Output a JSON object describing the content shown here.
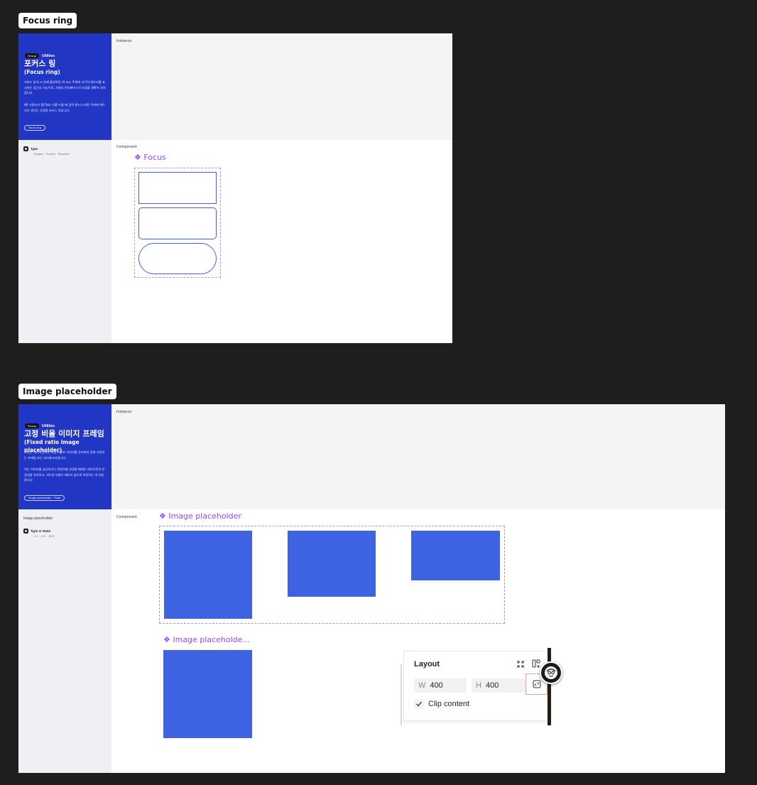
{
  "focus_section": {
    "tag": "Focus ring",
    "hero": {
      "badge": "Group",
      "category": "Utilities",
      "title_ko": "포커스 링",
      "title_en": "(Focus ring)",
      "desc1": "키보드 탐색 시 현재 활성화된 UI 요소 주위에 시각적 테두리를 표시하는 접근성 기능으로, 사용자 인터페이스의 초점을 명확히 보여줍니다.",
      "desc2": "예) 사용자가 탭(Tab) 키를 누를 때 입력 필드나 버튼 주위에 테두리가 생기는 것처럼 포커스 링입니다.",
      "pill": "Focus ring"
    },
    "instance_label": "Instance",
    "component_label": "Component",
    "component_title": "❖ Focus",
    "props": {
      "name": "Type",
      "options": "◦ Square   ◦ Current   ◦ Rounded"
    }
  },
  "image_section": {
    "tag": "Image placeholder",
    "hero": {
      "badge": "Group",
      "category": "Utilities",
      "title_ko": "고정 비율 이미지 프레임",
      "title_en": "(Fixed ratio image placeholder)",
      "desc1": "디자인 레이아웃에서 특정 비율로 이미지를 유지하여 정해 사용하는 프레임 또는 자리표시자입니다.",
      "desc2": "이는 이미지를 삽입하거나 콘텐츠를 변경할 때에도 레이아웃의 안정성을 유지하고, 의도한 비율이 깨지지 않도록 보장하는 데 유용합니다.",
      "pill": "Image placeholder - Fixed"
    },
    "instance_label": "Instance",
    "component_label": "Component",
    "sidebar_heading": "Image placeholder",
    "props": {
      "name": "Type or Ratio",
      "options": "◦ 1:1   ◦ 4:3   ◦ 16:9"
    },
    "component_title": "❖ Image placeholder",
    "second_title": "❖ Image placeholde..."
  },
  "layout_panel": {
    "title": "Layout",
    "w_label": "W",
    "w_value": "400",
    "h_label": "H",
    "h_value": "400",
    "clip_label": "Clip content",
    "clip_checked": true
  },
  "colors": {
    "hero_blue": "#2236c5",
    "component_purple": "#9747ff",
    "placeholder_blue": "#3e63e2"
  }
}
